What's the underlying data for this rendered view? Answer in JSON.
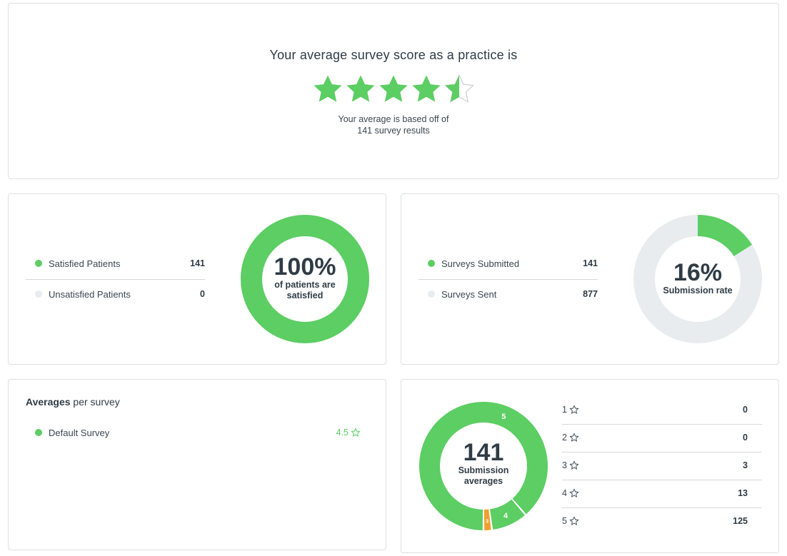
{
  "colors": {
    "green": "#5cce63",
    "grey": "#e8ecef",
    "orange": "#f0a030",
    "text": "#2f3b45"
  },
  "score": {
    "title": "Your average survey score as a practice is",
    "rating": 4.5,
    "max_rating": 5,
    "sub_line1": "Your average is based off of",
    "sub_line2": "141 survey results"
  },
  "satisfaction": {
    "items": [
      {
        "label": "Satisfied Patients",
        "value": "141",
        "color": "#5cce63"
      },
      {
        "label": "Unsatisfied Patients",
        "value": "0",
        "color": "#e8ecef"
      }
    ],
    "percent_label": "100%",
    "caption_line1": "of patients are",
    "caption_line2": "satisfied",
    "fraction": 1.0
  },
  "submission": {
    "items": [
      {
        "label": "Surveys Submitted",
        "value": "141",
        "color": "#5cce63"
      },
      {
        "label": "Surveys Sent",
        "value": "877",
        "color": "#e8ecef"
      }
    ],
    "percent_label": "16%",
    "caption": "Submission rate",
    "fraction": 0.16
  },
  "averages": {
    "title_bold": "Averages",
    "title_rest": " per survey",
    "surveys": [
      {
        "name": "Default Survey",
        "score": "4.5"
      }
    ]
  },
  "submission_averages": {
    "total": "141",
    "caption_line1": "Submission",
    "caption_line2": "averages",
    "segment_labels": {
      "five": "5",
      "four": "4",
      "three": "3"
    },
    "ratings": [
      {
        "stars": "1",
        "count": "0",
        "value": 0
      },
      {
        "stars": "2",
        "count": "0",
        "value": 0
      },
      {
        "stars": "3",
        "count": "3",
        "value": 3
      },
      {
        "stars": "4",
        "count": "13",
        "value": 13
      },
      {
        "stars": "5",
        "count": "125",
        "value": 125
      }
    ]
  }
}
